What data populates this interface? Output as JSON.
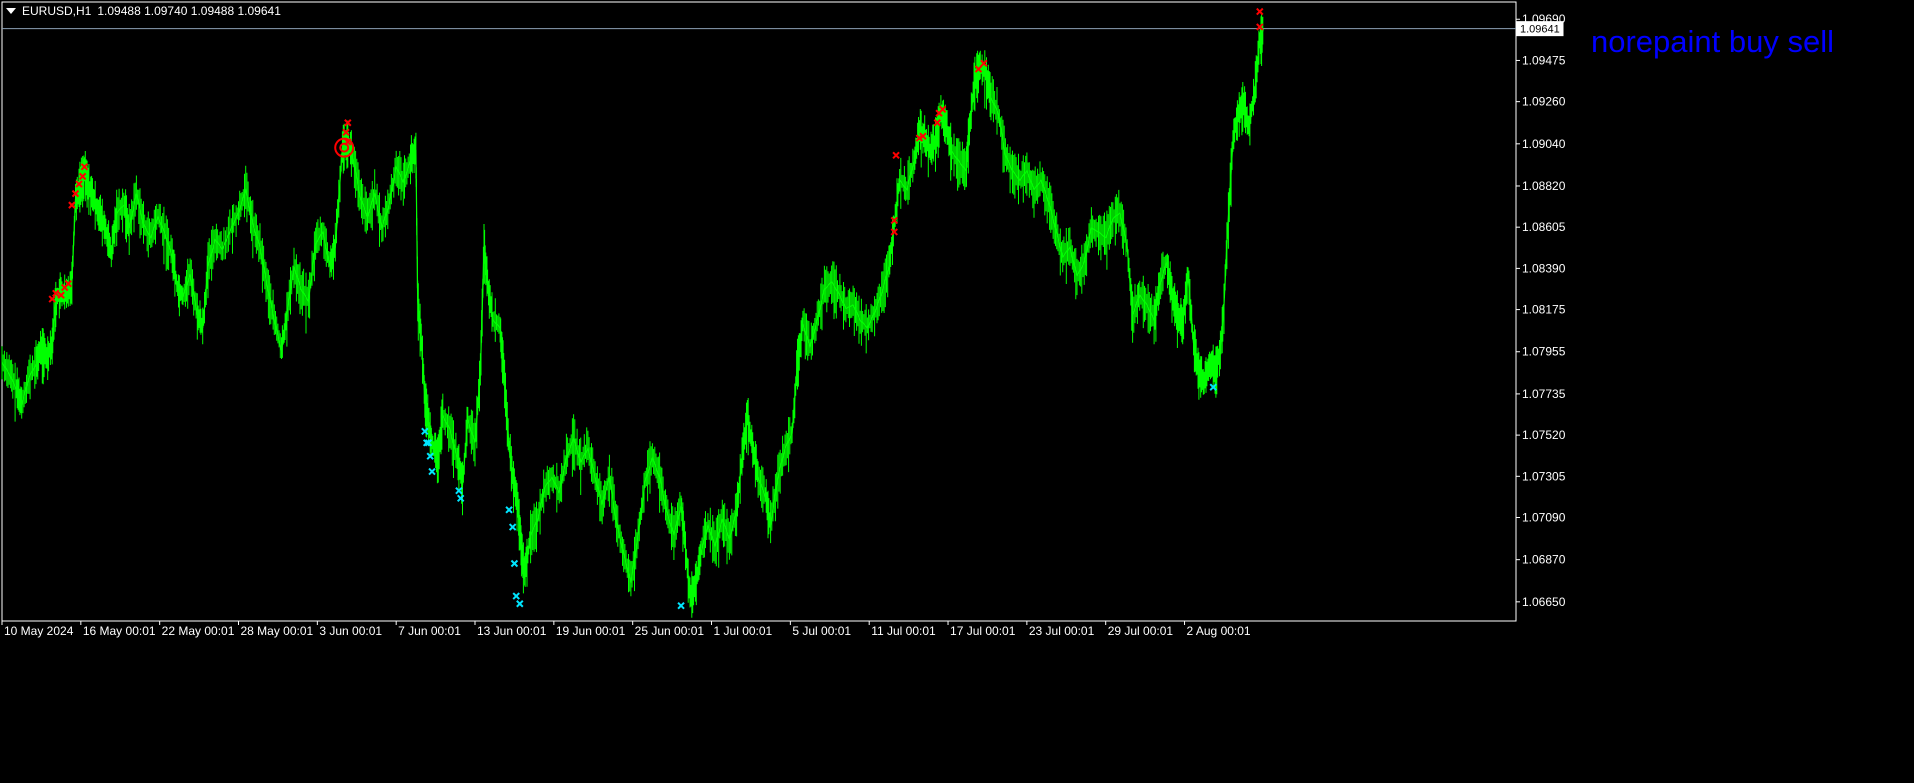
{
  "header": {
    "menu_icon": "dropdown-triangle-icon",
    "symbol": "EURUSD,H1",
    "ohlc": "1.09488 1.09740 1.09488 1.09641"
  },
  "overlay": {
    "title": "norepaint buy sell",
    "color": "#0000ff"
  },
  "current_price": {
    "label": "1.09641",
    "value": 1.09641
  },
  "colors": {
    "background": "#000000",
    "line": "#00ff00",
    "sell_marker": "#ff0000",
    "buy_marker": "#00e5ff",
    "axis": "#ffffff",
    "price_line": "#8ca0b4",
    "circle_marker": "#ff0000"
  },
  "chart_data": {
    "type": "line",
    "title": "",
    "xlabel": "",
    "ylabel": "",
    "ylim": [
      1.0655,
      1.0978
    ],
    "xlim": [
      0,
      84.5
    ],
    "grid": false,
    "y_ticks": [
      "1.09690",
      "1.09475",
      "1.09260",
      "1.09040",
      "1.08820",
      "1.08605",
      "1.08390",
      "1.08175",
      "1.07955",
      "1.07735",
      "1.07520",
      "1.07305",
      "1.07090",
      "1.06870",
      "1.06650"
    ],
    "x_ticks": [
      {
        "label": "10 May 2024",
        "x": 0
      },
      {
        "label": "16 May 00:01",
        "x": 4.4
      },
      {
        "label": "22 May 00:01",
        "x": 8.8
      },
      {
        "label": "28 May 00:01",
        "x": 13.2
      },
      {
        "label": "3 Jun 00:01",
        "x": 17.6
      },
      {
        "label": "7 Jun 00:01",
        "x": 22.0
      },
      {
        "label": "13 Jun 00:01",
        "x": 26.4
      },
      {
        "label": "19 Jun 00:01",
        "x": 30.8
      },
      {
        "label": "25 Jun 00:01",
        "x": 35.2
      },
      {
        "label": "1 Jul 00:01",
        "x": 39.6
      },
      {
        "label": "5 Jul 00:01",
        "x": 44.0
      },
      {
        "label": "11 Jul 00:01",
        "x": 48.4
      },
      {
        "label": "17 Jul 00:01",
        "x": 52.8
      },
      {
        "label": "23 Jul 00:01",
        "x": 57.2
      },
      {
        "label": "29 Jul 00:01",
        "x": 61.6
      },
      {
        "label": "2 Aug 00:01",
        "x": 66.0
      }
    ],
    "series": [
      {
        "points": [
          [
            0.0,
            1.079
          ],
          [
            0.4,
            1.0784
          ],
          [
            0.8,
            1.0776
          ],
          [
            1.1,
            1.0768
          ],
          [
            1.5,
            1.0782
          ],
          [
            1.9,
            1.0789
          ],
          [
            2.2,
            1.0797
          ],
          [
            2.5,
            1.0792
          ],
          [
            2.8,
            1.08
          ],
          [
            3.0,
            1.0822
          ],
          [
            3.3,
            1.0826
          ],
          [
            3.6,
            1.0824
          ],
          [
            3.9,
            1.0832
          ],
          [
            4.1,
            1.0875
          ],
          [
            4.4,
            1.0884
          ],
          [
            4.6,
            1.0889
          ],
          [
            4.9,
            1.088
          ],
          [
            5.2,
            1.0872
          ],
          [
            5.5,
            1.0866
          ],
          [
            5.8,
            1.0858
          ],
          [
            6.1,
            1.0846
          ],
          [
            6.4,
            1.0868
          ],
          [
            6.8,
            1.0872
          ],
          [
            7.1,
            1.086
          ],
          [
            7.5,
            1.0878
          ],
          [
            7.9,
            1.0862
          ],
          [
            8.3,
            1.0855
          ],
          [
            8.7,
            1.0866
          ],
          [
            9.1,
            1.0857
          ],
          [
            9.5,
            1.0845
          ],
          [
            9.8,
            1.0828
          ],
          [
            10.1,
            1.0824
          ],
          [
            10.5,
            1.0836
          ],
          [
            10.9,
            1.0815
          ],
          [
            11.2,
            1.0808
          ],
          [
            11.5,
            1.084
          ],
          [
            11.9,
            1.0854
          ],
          [
            12.3,
            1.0849
          ],
          [
            12.8,
            1.086
          ],
          [
            13.2,
            1.0868
          ],
          [
            13.6,
            1.088
          ],
          [
            14.0,
            1.0862
          ],
          [
            14.4,
            1.085
          ],
          [
            14.8,
            1.083
          ],
          [
            15.2,
            1.0812
          ],
          [
            15.6,
            1.0796
          ],
          [
            15.9,
            1.0815
          ],
          [
            16.3,
            1.084
          ],
          [
            16.7,
            1.0828
          ],
          [
            17.1,
            1.0822
          ],
          [
            17.5,
            1.0852
          ],
          [
            17.9,
            1.0858
          ],
          [
            18.3,
            1.084
          ],
          [
            18.6,
            1.085
          ],
          [
            19.0,
            1.0902
          ],
          [
            19.3,
            1.0906
          ],
          [
            19.6,
            1.0896
          ],
          [
            20.0,
            1.0876
          ],
          [
            20.4,
            1.0866
          ],
          [
            20.8,
            1.0878
          ],
          [
            21.2,
            1.086
          ],
          [
            21.6,
            1.0872
          ],
          [
            22.0,
            1.0892
          ],
          [
            22.4,
            1.0884
          ],
          [
            22.8,
            1.0895
          ],
          [
            23.1,
            1.09
          ],
          [
            23.2,
            1.0822
          ],
          [
            23.4,
            1.0802
          ],
          [
            23.6,
            1.0772
          ],
          [
            23.8,
            1.0758
          ],
          [
            24.0,
            1.0748
          ],
          [
            24.3,
            1.0738
          ],
          [
            24.6,
            1.0762
          ],
          [
            25.0,
            1.0755
          ],
          [
            25.4,
            1.074
          ],
          [
            25.7,
            1.0726
          ],
          [
            26.0,
            1.076
          ],
          [
            26.4,
            1.0748
          ],
          [
            26.7,
            1.0785
          ],
          [
            26.9,
            1.085
          ],
          [
            27.1,
            1.083
          ],
          [
            27.4,
            1.0812
          ],
          [
            27.8,
            1.0808
          ],
          [
            28.0,
            1.0785
          ],
          [
            28.3,
            1.0746
          ],
          [
            28.5,
            1.073
          ],
          [
            28.8,
            1.0714
          ],
          [
            29.0,
            1.069
          ],
          [
            29.2,
            1.068
          ],
          [
            29.5,
            1.07
          ],
          [
            29.9,
            1.0708
          ],
          [
            30.3,
            1.0725
          ],
          [
            30.7,
            1.073
          ],
          [
            31.1,
            1.0722
          ],
          [
            31.5,
            1.074
          ],
          [
            31.9,
            1.075
          ],
          [
            32.3,
            1.0738
          ],
          [
            32.7,
            1.0745
          ],
          [
            33.1,
            1.073
          ],
          [
            33.5,
            1.0716
          ],
          [
            33.9,
            1.073
          ],
          [
            34.3,
            1.0706
          ],
          [
            34.7,
            1.069
          ],
          [
            35.1,
            1.0675
          ],
          [
            35.5,
            1.07
          ],
          [
            35.9,
            1.0728
          ],
          [
            36.3,
            1.074
          ],
          [
            36.7,
            1.073
          ],
          [
            37.1,
            1.0712
          ],
          [
            37.5,
            1.07
          ],
          [
            37.9,
            1.0715
          ],
          [
            38.1,
            1.0698
          ],
          [
            38.4,
            1.0668
          ],
          [
            38.7,
            1.0672
          ],
          [
            39.0,
            1.069
          ],
          [
            39.4,
            1.0705
          ],
          [
            39.8,
            1.0694
          ],
          [
            40.2,
            1.0708
          ],
          [
            40.6,
            1.0698
          ],
          [
            41.0,
            1.0712
          ],
          [
            41.3,
            1.074
          ],
          [
            41.6,
            1.0762
          ],
          [
            41.9,
            1.0745
          ],
          [
            42.2,
            1.073
          ],
          [
            42.6,
            1.072
          ],
          [
            42.9,
            1.0705
          ],
          [
            43.3,
            1.073
          ],
          [
            43.7,
            1.0745
          ],
          [
            44.1,
            1.0753
          ],
          [
            44.4,
            1.079
          ],
          [
            44.7,
            1.081
          ],
          [
            45.1,
            1.0798
          ],
          [
            45.5,
            1.0812
          ],
          [
            45.9,
            1.0828
          ],
          [
            46.3,
            1.0832
          ],
          [
            46.7,
            1.0826
          ],
          [
            47.1,
            1.0818
          ],
          [
            47.5,
            1.082
          ],
          [
            47.9,
            1.0812
          ],
          [
            48.3,
            1.0808
          ],
          [
            48.7,
            1.0816
          ],
          [
            49.1,
            1.0826
          ],
          [
            49.5,
            1.084
          ],
          [
            49.8,
            1.0862
          ],
          [
            50.1,
            1.0885
          ],
          [
            50.5,
            1.088
          ],
          [
            50.9,
            1.0895
          ],
          [
            51.2,
            1.091
          ],
          [
            51.5,
            1.0906
          ],
          [
            51.8,
            1.09
          ],
          [
            52.1,
            1.0905
          ],
          [
            52.4,
            1.092
          ],
          [
            52.7,
            1.0913
          ],
          [
            53.0,
            1.09
          ],
          [
            53.4,
            1.0895
          ],
          [
            53.8,
            1.089
          ],
          [
            54.0,
            1.0912
          ],
          [
            54.3,
            1.0938
          ],
          [
            54.6,
            1.0944
          ],
          [
            54.9,
            1.094
          ],
          [
            55.2,
            1.0928
          ],
          [
            55.6,
            1.092
          ],
          [
            56.0,
            1.0898
          ],
          [
            56.4,
            1.089
          ],
          [
            56.8,
            1.0885
          ],
          [
            57.2,
            1.089
          ],
          [
            57.6,
            1.088
          ],
          [
            58.0,
            1.0885
          ],
          [
            58.4,
            1.0874
          ],
          [
            58.8,
            1.086
          ],
          [
            59.2,
            1.0845
          ],
          [
            59.6,
            1.085
          ],
          [
            60.0,
            1.0835
          ],
          [
            60.4,
            1.0842
          ],
          [
            60.8,
            1.086
          ],
          [
            61.2,
            1.0858
          ],
          [
            61.6,
            1.0855
          ],
          [
            62.0,
            1.0865
          ],
          [
            62.4,
            1.0868
          ],
          [
            62.8,
            1.085
          ],
          [
            63.1,
            1.0815
          ],
          [
            63.5,
            1.0825
          ],
          [
            63.9,
            1.082
          ],
          [
            64.3,
            1.0812
          ],
          [
            64.6,
            1.083
          ],
          [
            65.0,
            1.0842
          ],
          [
            65.3,
            1.0825
          ],
          [
            65.6,
            1.0815
          ],
          [
            65.9,
            1.081
          ],
          [
            66.2,
            1.0835
          ],
          [
            66.5,
            1.08
          ],
          [
            66.8,
            1.0785
          ],
          [
            67.1,
            1.078
          ],
          [
            67.4,
            1.079
          ],
          [
            67.7,
            1.0785
          ],
          [
            68.0,
            1.0795
          ],
          [
            68.2,
            1.082
          ],
          [
            68.4,
            1.0858
          ],
          [
            68.7,
            1.0905
          ],
          [
            69.0,
            1.092
          ],
          [
            69.3,
            1.0925
          ],
          [
            69.6,
            1.0912
          ],
          [
            69.9,
            1.093
          ],
          [
            70.2,
            1.0958
          ],
          [
            70.4,
            1.0964
          ]
        ]
      }
    ],
    "sell_signals": [
      [
        2.8,
        1.0823
      ],
      [
        3.0,
        1.0826
      ],
      [
        3.3,
        1.0825
      ],
      [
        3.5,
        1.0829
      ],
      [
        3.7,
        1.0831
      ],
      [
        3.9,
        1.0872
      ],
      [
        4.1,
        1.0878
      ],
      [
        4.3,
        1.0883
      ],
      [
        4.5,
        1.0887
      ],
      [
        4.6,
        1.0892
      ],
      [
        19.2,
        1.091
      ],
      [
        19.3,
        1.0915
      ],
      [
        19.3,
        1.0905
      ],
      [
        49.8,
        1.0858
      ],
      [
        49.8,
        1.0864
      ],
      [
        49.9,
        1.0898
      ],
      [
        51.2,
        1.0907
      ],
      [
        51.4,
        1.0908
      ],
      [
        52.2,
        1.0915
      ],
      [
        52.3,
        1.092
      ],
      [
        52.5,
        1.0922
      ],
      [
        54.5,
        1.0943
      ],
      [
        54.8,
        1.0946
      ],
      [
        70.2,
        1.0965
      ],
      [
        70.2,
        1.0973
      ]
    ],
    "buy_signals": [
      [
        23.6,
        1.0754
      ],
      [
        23.7,
        1.0748
      ],
      [
        23.8,
        1.0748
      ],
      [
        23.9,
        1.0741
      ],
      [
        24.0,
        1.0733
      ],
      [
        25.5,
        1.0723
      ],
      [
        25.6,
        1.0719
      ],
      [
        28.3,
        1.0713
      ],
      [
        28.5,
        1.0704
      ],
      [
        28.6,
        1.0685
      ],
      [
        28.7,
        1.0668
      ],
      [
        28.9,
        1.0664
      ],
      [
        37.9,
        1.0663
      ],
      [
        67.6,
        1.0777
      ]
    ],
    "circle_markers": [
      [
        19.1,
        1.0902
      ]
    ]
  }
}
